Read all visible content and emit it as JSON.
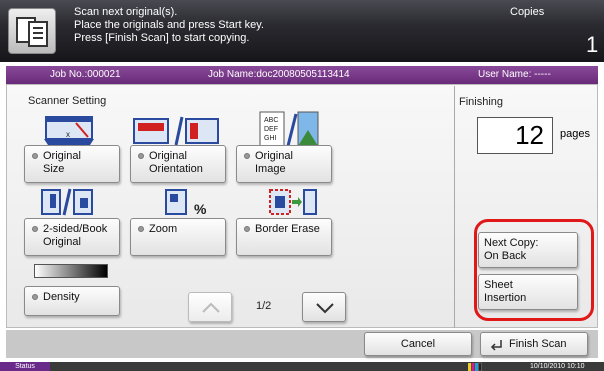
{
  "header": {
    "message_lines": [
      "Scan next original(s).",
      "Place the originals and press Start key.",
      "Press [Finish Scan] to start copying."
    ],
    "mode": "Copies",
    "copy_count": "1"
  },
  "jobbar": {
    "job_no": "Job No.:000021",
    "job_name": "Job Name:doc20080505113414",
    "user_name": "User Name: -----"
  },
  "scanner": {
    "title": "Scanner Setting",
    "buttons": {
      "original_size": [
        "Original",
        "Size"
      ],
      "original_orientation": [
        "Original",
        "Orientation"
      ],
      "original_image": [
        "Original",
        "Image"
      ],
      "two_sided": [
        "2-sided/Book",
        "Original"
      ],
      "zoom": "Zoom",
      "border_erase": "Border Erase",
      "density": "Density"
    },
    "zoom_symbol": "%",
    "page_indicator": "1/2"
  },
  "finishing": {
    "title": "Finishing",
    "pages_value": "12",
    "pages_unit": "pages",
    "next_copy": [
      "Next Copy:",
      "On Back"
    ],
    "sheet_insertion": [
      "Sheet",
      "Insertion"
    ]
  },
  "actions": {
    "cancel": "Cancel",
    "finish_scan": "Finish Scan"
  },
  "statusbar": {
    "status": "Status",
    "datetime": "10/10/2010  10:10"
  },
  "colors": {
    "highlight_ring": "#e01818",
    "job_bar": "#6a2a7a",
    "icon_blue": "#2a4aa0"
  }
}
